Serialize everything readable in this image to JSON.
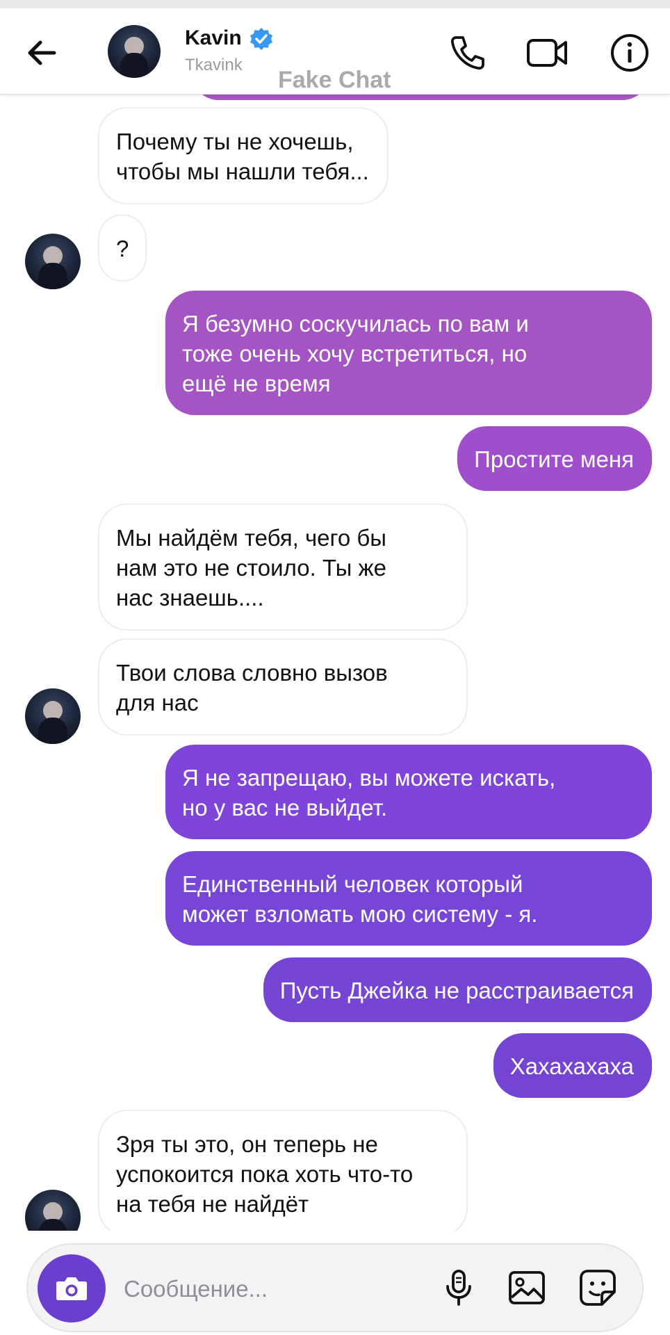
{
  "header": {
    "contact_name": "Kavin",
    "username": "Tkavink",
    "watermark": "Fake Chat",
    "icons": [
      "back-arrow-icon",
      "verified-badge-icon",
      "phone-icon",
      "video-camera-icon",
      "info-icon"
    ]
  },
  "messages": [
    {
      "side": "in",
      "text": "Почему ты не хочешь,\nчтобы мы нашли тебя...",
      "avatar": false
    },
    {
      "side": "in",
      "text": "?",
      "avatar": true
    },
    {
      "side": "out",
      "text": "Я безумно соскучилась по вам и\nтоже очень хочу встретиться, но\nещё не время",
      "color": "#a454c3"
    },
    {
      "side": "out",
      "text": "Простите меня",
      "color": "#9f4fcb"
    },
    {
      "side": "in",
      "text": "Мы найдём тебя, чего бы\nнам это не стоило. Ты же\nнас знаешь....",
      "avatar": false
    },
    {
      "side": "in",
      "text": "Твои слова словно вызов\nдля нас",
      "avatar": true
    },
    {
      "side": "out",
      "text": "Я не запрещаю, вы можете искать,\nно у вас не выйдет.",
      "color": "#7f44d9"
    },
    {
      "side": "out",
      "text": "Единственный человек который\nможет взломать мою систему - я.",
      "color": "#7846d6"
    },
    {
      "side": "out",
      "text": "Пусть Джейка не расстраивается",
      "color": "#7546d3"
    },
    {
      "side": "out",
      "text": "Хахахахаха",
      "color": "#7345d2"
    },
    {
      "side": "in",
      "text": "Зря ты это, он теперь не\nуспокоится пока хоть что-то\nна тебя не найдёт",
      "avatar": true
    }
  ],
  "composer": {
    "placeholder": "Сообщение...",
    "value": "",
    "icons": [
      "camera-icon",
      "microphone-icon",
      "image-icon",
      "sticker-icon"
    ],
    "accent": "#6a3fcf"
  }
}
